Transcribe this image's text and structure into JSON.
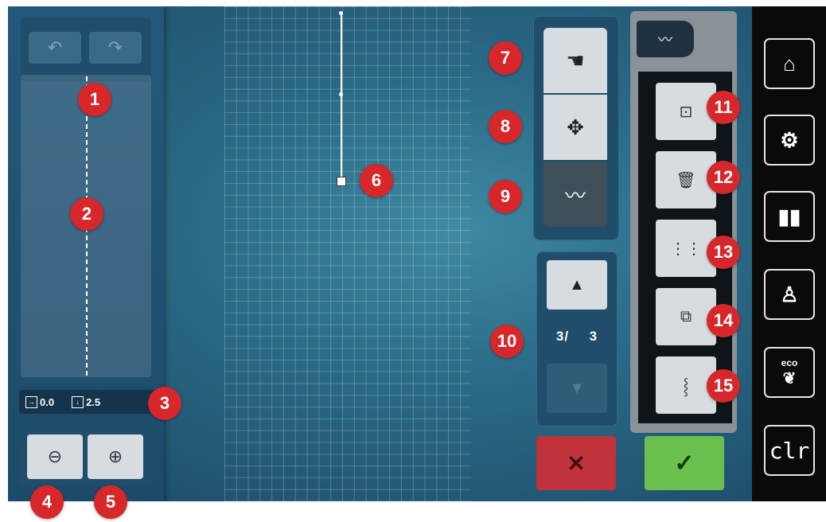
{
  "left_panel": {
    "undo_icon": "undo-arrow-icon",
    "redo_icon": "redo-arrow-icon",
    "info": {
      "stitch_width_value": "0.0",
      "stitch_length_value": "2.5"
    },
    "zoom_out_icon": "zoom-out-icon",
    "zoom_in_icon": "zoom-in-icon"
  },
  "tools": [
    {
      "icon": "hand-icon",
      "glyph": "☚"
    },
    {
      "icon": "move-icon",
      "glyph": "✥"
    },
    {
      "icon": "draw-stitch-icon",
      "glyph": "〰"
    }
  ],
  "pager": {
    "current": "3",
    "separator": "/",
    "total": "3",
    "up_glyph": "▲",
    "down_glyph": "▼"
  },
  "actions": {
    "cancel_glyph": "✕",
    "confirm_glyph": "✓"
  },
  "sub_menu": {
    "tab_glyph": "〰",
    "items": [
      {
        "icon": "new-stitch-icon",
        "glyph": "⊡"
      },
      {
        "icon": "trash-icon",
        "glyph": "🗑"
      },
      {
        "icon": "stitch-pattern-icon",
        "glyph": "⋮⋮"
      },
      {
        "icon": "layers-icon",
        "glyph": "⧉"
      },
      {
        "icon": "stitch-path-icon",
        "glyph": "⸾"
      }
    ]
  },
  "sidebar": {
    "eco_label": "eco",
    "clr_label": "clr"
  },
  "callouts": [
    "1",
    "2",
    "3",
    "4",
    "5",
    "6",
    "7",
    "8",
    "9",
    "10",
    "11",
    "12",
    "13",
    "14",
    "15"
  ],
  "colors": {
    "callout": "#d7272a",
    "cancel": "#c0323c",
    "confirm": "#6bbf4e",
    "sidebar": "#0a0a0a"
  }
}
